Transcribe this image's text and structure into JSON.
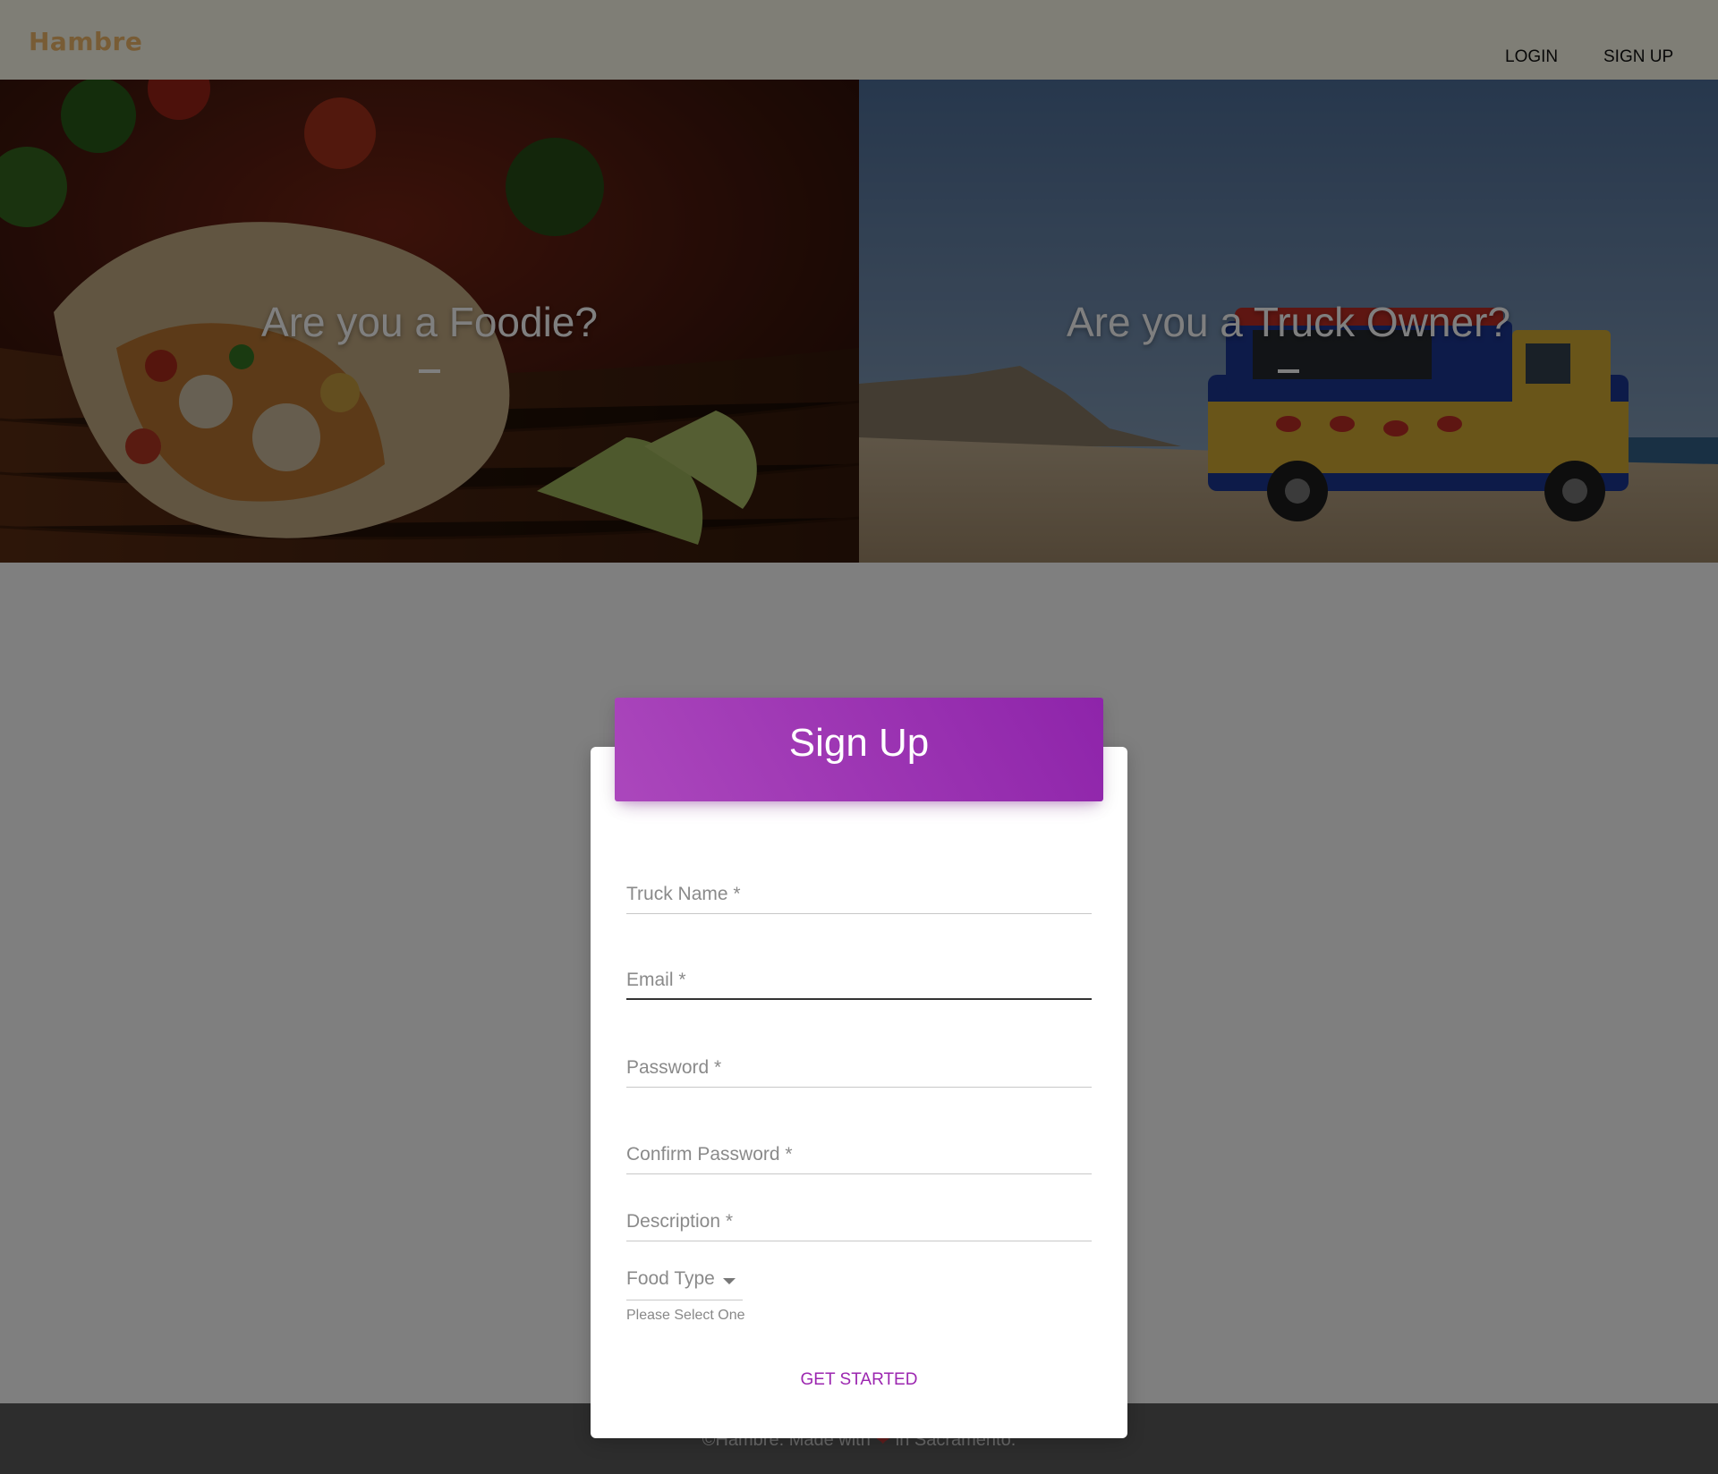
{
  "navbar": {
    "brand": "Hambre",
    "login_label": "LOGIN",
    "signup_label": "SIGN UP"
  },
  "hero": {
    "foodie_title": "Are you a Foodie?",
    "owner_title": "Are you a Truck Owner?"
  },
  "footer": {
    "text_before": "©Hambre. Made with",
    "heart": "❤",
    "text_after": "in Sacramento."
  },
  "signup_form": {
    "title": "Sign Up",
    "fields": {
      "truck_name": "Truck Name *",
      "email": "Email *",
      "password": "Password *",
      "confirm_password": "Confirm Password *",
      "description": "Description *"
    },
    "food_type": {
      "label": "Food Type",
      "helper": "Please Select One"
    },
    "submit_label": "GET STARTED"
  },
  "colors": {
    "accent": "#9c27b0",
    "header_gradient_start": "#ab47bc",
    "header_gradient_end": "#8e24aa",
    "brand": "#f0b86a",
    "navbar_bg": "#fffded",
    "footer_bg": "#5a5a5a"
  }
}
